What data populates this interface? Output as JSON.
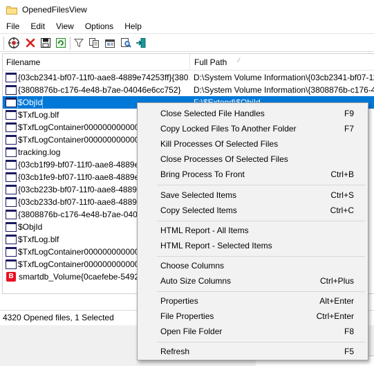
{
  "window": {
    "title": "OpenedFilesView"
  },
  "menubar": {
    "items": [
      "File",
      "Edit",
      "View",
      "Options",
      "Help"
    ]
  },
  "toolbar": {
    "buttons": [
      "properties-icon",
      "close-handle-icon",
      "save-icon",
      "refresh-icon",
      "filter-icon",
      "copy-icon",
      "html-report-icon",
      "find-icon",
      "exit-icon"
    ]
  },
  "list": {
    "columns": {
      "filename": "Filename",
      "full_path": "Full Path"
    },
    "rows": [
      {
        "filename": "{03cb2341-bf07-11f0-aae8-4889e74253ff}{380...",
        "path": "D:\\System Volume Information\\{03cb2341-bf07-11f0",
        "icon": "file"
      },
      {
        "filename": "{3808876b-c176-4e48-b7ae-04046e6cc752}",
        "path": "D:\\System Volume Information\\{3808876b-c176-4e4",
        "icon": "file"
      },
      {
        "filename": "$ObjId",
        "path": "F:\\$Extend\\$ObjId",
        "icon": "file",
        "selected": true
      },
      {
        "filename": "$TxfLog.blf",
        "path": "",
        "icon": "file"
      },
      {
        "filename": "$TxfLogContainer0000000000000",
        "path": "",
        "icon": "file"
      },
      {
        "filename": "$TxfLogContainer0000000000000",
        "path": "",
        "icon": "file"
      },
      {
        "filename": "tracking.log",
        "path": "",
        "icon": "file"
      },
      {
        "filename": "{03cb1f99-bf07-11f0-aae8-4889e",
        "path": "",
        "icon": "file"
      },
      {
        "filename": "{03cb1fe9-bf07-11f0-aae8-4889e",
        "path": "",
        "icon": "file"
      },
      {
        "filename": "{03cb223b-bf07-11f0-aae8-4889e",
        "path": "",
        "icon": "file"
      },
      {
        "filename": "{03cb233d-bf07-11f0-aae8-4889e",
        "path": "",
        "icon": "file"
      },
      {
        "filename": "{3808876b-c176-4e48-b7ae-04046",
        "path": "",
        "icon": "file"
      },
      {
        "filename": "$ObjId",
        "path": "",
        "icon": "file"
      },
      {
        "filename": "$TxfLog.blf",
        "path": "",
        "icon": "file"
      },
      {
        "filename": "$TxfLogContainer0000000000000",
        "path": "",
        "icon": "file"
      },
      {
        "filename": "$TxfLogContainer0000000000000",
        "path": "",
        "icon": "file"
      },
      {
        "filename": "smartdb_Volume{0caefebe-5492-",
        "path": "",
        "icon": "b"
      }
    ]
  },
  "status": {
    "text": "4320 Opened files, 1 Selected"
  },
  "context_menu": {
    "items": [
      {
        "label": "Close Selected File Handles",
        "shortcut": "F9"
      },
      {
        "label": "Copy Locked Files To Another Folder",
        "shortcut": "F7"
      },
      {
        "label": "Kill Processes Of Selected Files",
        "shortcut": ""
      },
      {
        "label": "Close Processes Of Selected Files",
        "shortcut": ""
      },
      {
        "label": "Bring Process To Front",
        "shortcut": "Ctrl+B"
      },
      {
        "separator": true
      },
      {
        "label": "Save Selected Items",
        "shortcut": "Ctrl+S"
      },
      {
        "label": "Copy Selected Items",
        "shortcut": "Ctrl+C"
      },
      {
        "separator": true
      },
      {
        "label": "HTML Report - All Items",
        "shortcut": ""
      },
      {
        "label": "HTML Report - Selected Items",
        "shortcut": ""
      },
      {
        "separator": true
      },
      {
        "label": "Choose Columns",
        "shortcut": ""
      },
      {
        "label": "Auto Size Columns",
        "shortcut": "Ctrl+Plus"
      },
      {
        "separator": true
      },
      {
        "label": "Properties",
        "shortcut": "Alt+Enter"
      },
      {
        "label": "File Properties",
        "shortcut": "Ctrl+Enter"
      },
      {
        "label": "Open File Folder",
        "shortcut": "F8"
      },
      {
        "separator": true
      },
      {
        "label": "Refresh",
        "shortcut": "F5"
      }
    ]
  },
  "colors": {
    "selection": "#0078d7",
    "menu_bg": "#f2f2f2",
    "b_icon": "#e81123"
  }
}
